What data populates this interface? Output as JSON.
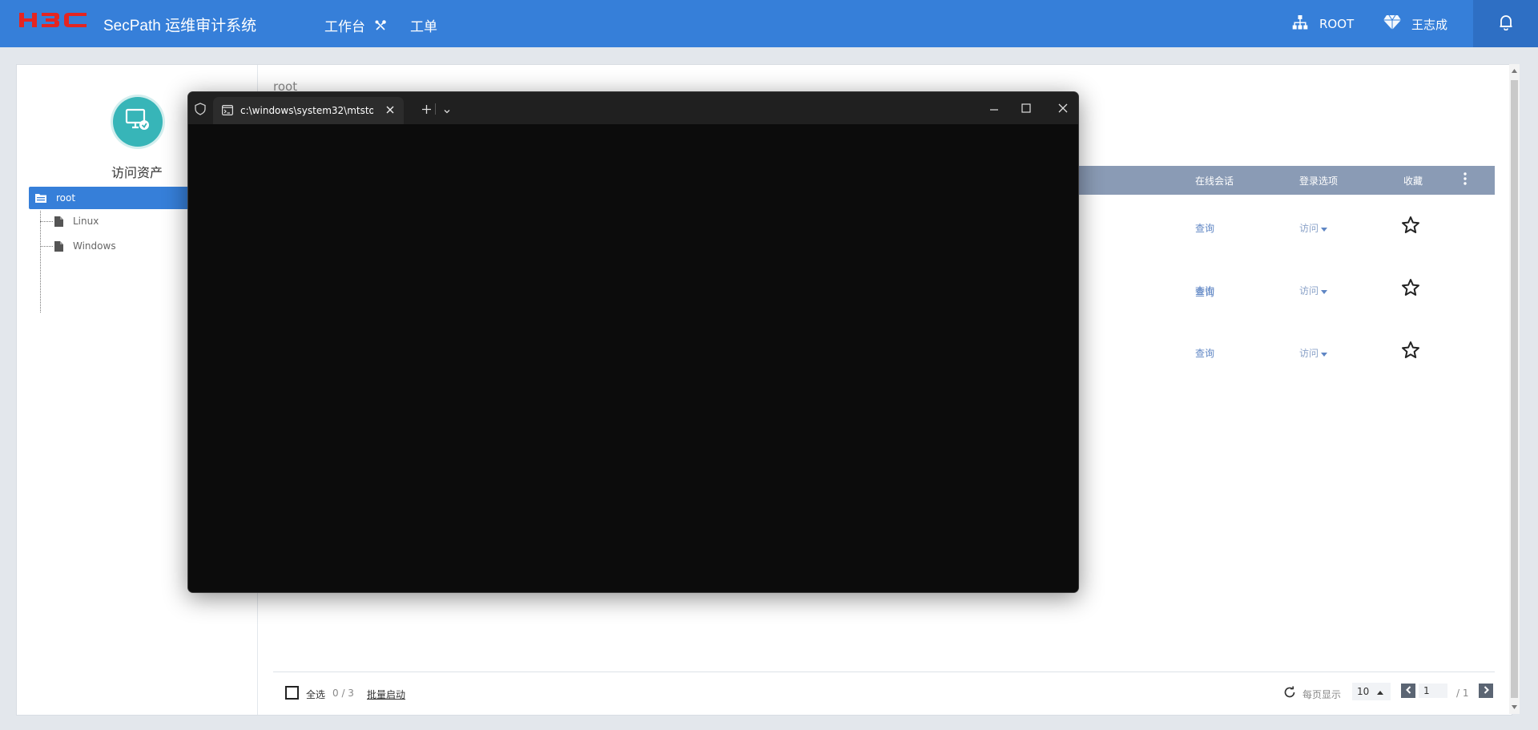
{
  "header": {
    "logo_text": "H3C",
    "app_title": "SecPath 运维审计系统",
    "nav": {
      "workbench": "工作台",
      "ticket": "工单"
    },
    "org": "ROOT",
    "user": "王志成"
  },
  "sidebar": {
    "title": "访问资产",
    "tree": {
      "root": "root",
      "children": [
        "Linux",
        "Windows"
      ]
    }
  },
  "main": {
    "breadcrumb": "root",
    "columns": {
      "online_session": "在线会话",
      "login_options": "登录选项",
      "favorite": "收藏"
    },
    "rows": [
      {
        "query": "查询",
        "access": "访问"
      },
      {
        "query": "查询",
        "access": "访问"
      },
      {
        "query": "查询",
        "access": "访问"
      }
    ],
    "footer": {
      "select_all": "全选",
      "selected_count": "0 / 3",
      "batch_start": "批量启动",
      "per_page_label": "每页显示",
      "per_page_value": "10",
      "current_page": "1",
      "total_pages": "/ 1"
    }
  },
  "terminal": {
    "tab_title": "c:\\windows\\system32\\mtstoc"
  },
  "colors": {
    "brand_blue": "#367fd9",
    "logo_red": "#e52521",
    "table_header": "#8a9bb5",
    "avatar_teal": "#37b5b8"
  }
}
